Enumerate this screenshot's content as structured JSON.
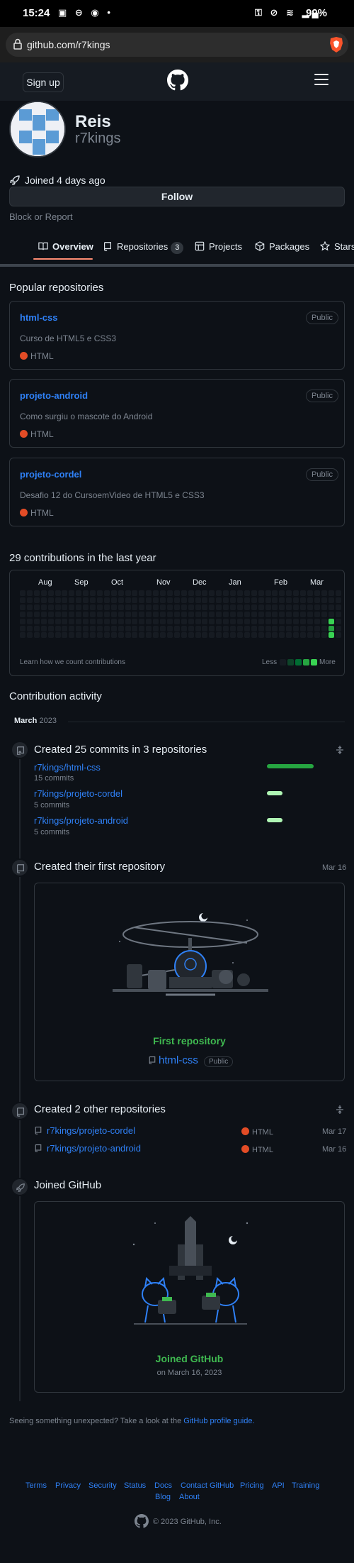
{
  "status": {
    "time": "15:24",
    "left_icons": "▣ ⊖ ◉ •",
    "right_icons": "⚿ ⊘ ≋ ▂▄",
    "battery": "99%"
  },
  "browser": {
    "url": "github.com/r7kings"
  },
  "header": {
    "signup_label": "Sign up"
  },
  "profile": {
    "name": "Reis",
    "login": "r7kings",
    "joined": "Joined 4 days ago",
    "follow_label": "Follow",
    "block_label": "Block or Report"
  },
  "tabs": [
    {
      "label": "Overview"
    },
    {
      "label": "Repositories",
      "count": "3"
    },
    {
      "label": "Projects"
    },
    {
      "label": "Packages"
    },
    {
      "label": "Stars"
    }
  ],
  "popular": {
    "title": "Popular repositories",
    "repos": [
      {
        "name": "html-css",
        "visibility": "Public",
        "description": "Curso de HTML5 e CSS3",
        "language": "HTML",
        "language_color": "#e34c26"
      },
      {
        "name": "projeto-android",
        "visibility": "Public",
        "description": "Como surgiu o mascote do Android",
        "language": "HTML",
        "language_color": "#e34c26"
      },
      {
        "name": "projeto-cordel",
        "visibility": "Public",
        "description": "Desafio 12 do CursoemVideo de HTML5 e CSS3",
        "language": "HTML",
        "language_color": "#e34c26"
      }
    ]
  },
  "contributions": {
    "title": "29 contributions in the last year",
    "months": [
      "Aug",
      "Sep",
      "Oct",
      "Nov",
      "Dec",
      "Jan",
      "Feb",
      "Mar"
    ],
    "learn_label": "Learn how we count contributions",
    "less_label": "Less",
    "more_label": "More",
    "colors": [
      "#161b22",
      "#0e4429",
      "#006d32",
      "#26a641",
      "#39d353"
    ]
  },
  "activity": {
    "title": "Contribution activity",
    "month_label": "March",
    "year_label": "2023",
    "commits_event": {
      "title": "Created 25 commits in 3 repositories",
      "repos": [
        {
          "name": "r7kings/html-css",
          "commits": "15 commits",
          "fraction": 1.0
        },
        {
          "name": "r7kings/projeto-cordel",
          "commits": "5 commits",
          "fraction": 0.33
        },
        {
          "name": "r7kings/projeto-android",
          "commits": "5 commits",
          "fraction": 0.33
        }
      ]
    },
    "first_repo_event": {
      "title": "Created their first repository",
      "date": "Mar 16",
      "card_title": "First repository",
      "repo_name": "html-css",
      "visibility": "Public"
    },
    "other_repos_event": {
      "title": "Created 2 other repositories",
      "repos": [
        {
          "name": "r7kings/projeto-cordel",
          "language": "HTML",
          "date": "Mar 17"
        },
        {
          "name": "r7kings/projeto-android",
          "language": "HTML",
          "date": "Mar 16"
        }
      ]
    },
    "joined_event": {
      "title": "Joined GitHub",
      "card_title": "Joined GitHub",
      "card_date": "on March 16, 2023"
    }
  },
  "unexpected": {
    "text": "Seeing something unexpected? Take a look at the",
    "link": "GitHub profile guide."
  },
  "footer": {
    "links": [
      "Terms",
      "Privacy",
      "Security",
      "Status",
      "Docs",
      "Contact GitHub",
      "Pricing",
      "API",
      "Training",
      "Blog",
      "About"
    ],
    "copyright": "© 2023 GitHub, Inc."
  }
}
